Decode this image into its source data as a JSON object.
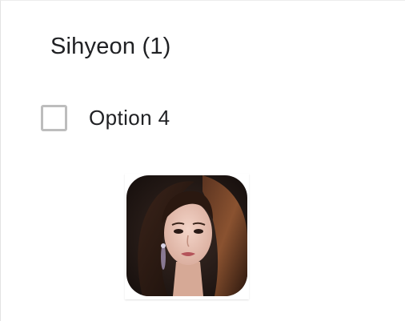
{
  "question": {
    "title": "Sihyeon (1)"
  },
  "options": [
    {
      "label": "Option 4",
      "checked": false
    }
  ],
  "image": {
    "subject": "portrait-photo",
    "alt": ""
  },
  "colors": {
    "text": "#202124",
    "checkbox_border": "#bdbdbd",
    "background": "#ffffff"
  }
}
